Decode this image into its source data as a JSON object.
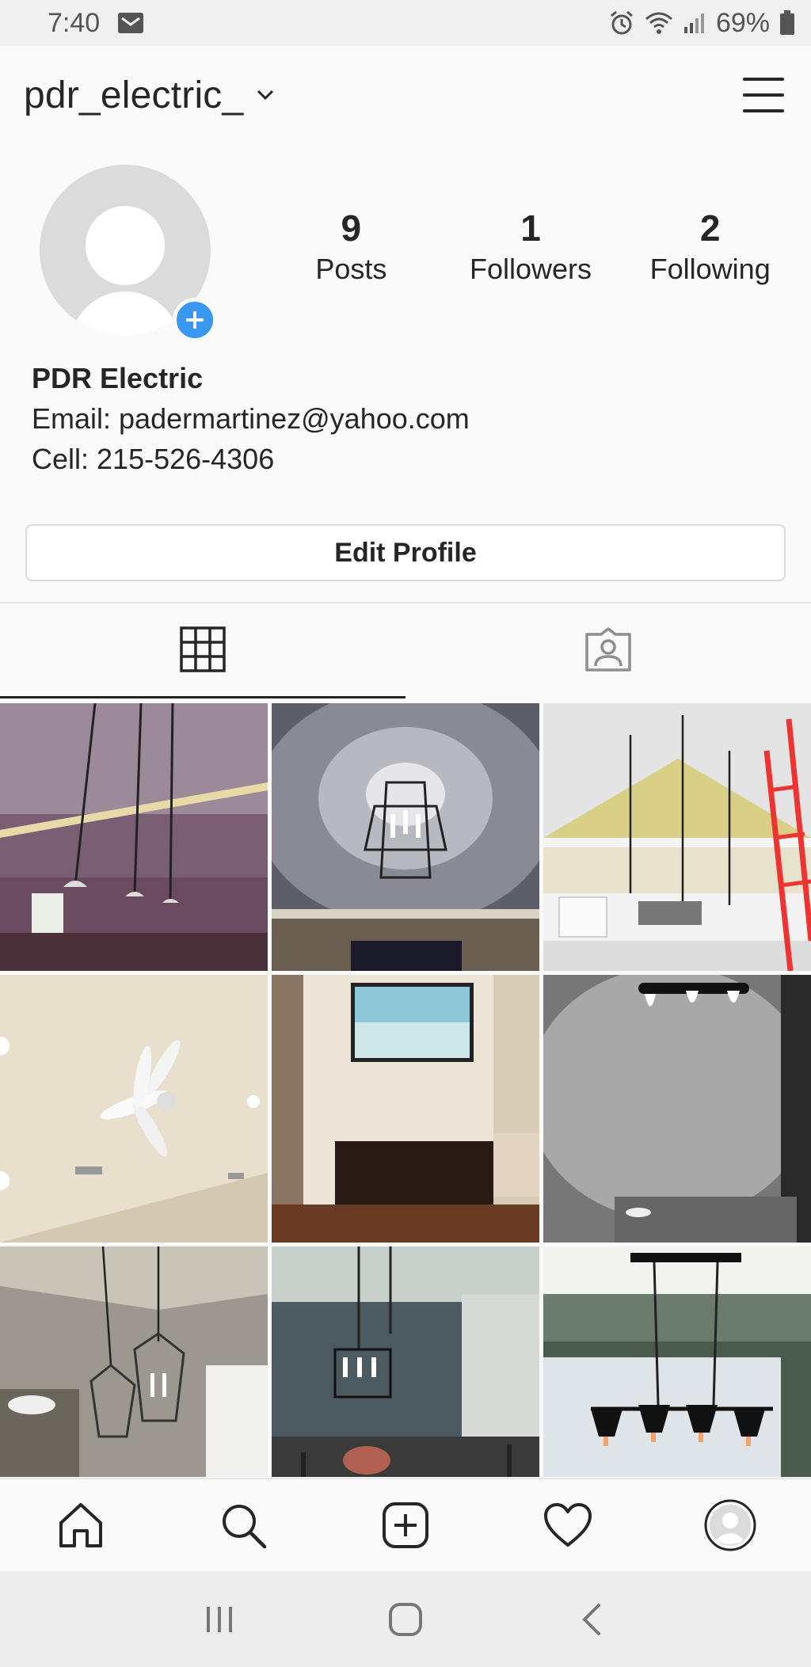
{
  "status_bar": {
    "time": "7:40",
    "battery": "69%",
    "icons": [
      "mail-icon",
      "alarm-icon",
      "wifi-icon",
      "signal-icon",
      "battery-icon"
    ]
  },
  "header": {
    "username": "pdr_electric_"
  },
  "profile": {
    "stats": [
      {
        "count": "9",
        "label": "Posts"
      },
      {
        "count": "1",
        "label": "Followers"
      },
      {
        "count": "2",
        "label": "Following"
      }
    ],
    "name": "PDR Electric",
    "bio_lines": [
      "Email: padermartinez@yahoo.com",
      "Cell: 215-526-4306"
    ],
    "edit_button": "Edit Profile"
  },
  "tabs": [
    {
      "icon": "grid-icon",
      "active": true
    },
    {
      "icon": "tagged-icon",
      "active": false
    }
  ],
  "posts": [
    {
      "subject": "pendant lights over kitchen island"
    },
    {
      "subject": "lantern ceiling fixture"
    },
    {
      "subject": "pendants in vaulted kitchen with ladder"
    },
    {
      "subject": "white ceiling fan"
    },
    {
      "subject": "mounted TV over dresser"
    },
    {
      "subject": "bathroom vanity light"
    },
    {
      "subject": "lantern pendants in foyer"
    },
    {
      "subject": "dining room chandelier"
    },
    {
      "subject": "linear chandelier with black shades"
    }
  ],
  "bottom_nav": [
    "home-icon",
    "search-icon",
    "new-post-icon",
    "activity-icon",
    "profile-icon"
  ],
  "colors": {
    "accent_blue": "#3897f0",
    "text": "#262626",
    "border": "#dbdbdb"
  }
}
